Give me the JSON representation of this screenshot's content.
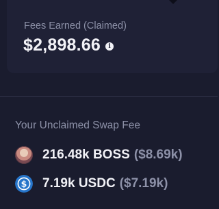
{
  "fees": {
    "label": "Fees Earned (Claimed)",
    "value": "$2,898.66",
    "info_glyph": "i"
  },
  "unclaimed": {
    "title": "Your Unclaimed Swap Fee",
    "tokens": [
      {
        "amount": "216.48k BOSS",
        "usd": "($8.69k)",
        "icon": "boss-token-icon"
      },
      {
        "amount": "7.19k USDC",
        "usd": "($7.19k)",
        "icon": "usdc-token-icon"
      }
    ]
  },
  "colors": {
    "background": "#1a1c2e",
    "card": "#1f2136",
    "primary_text": "#f2f2f7",
    "muted_text": "#8d91a8",
    "usdc_blue": "#2775ca"
  }
}
